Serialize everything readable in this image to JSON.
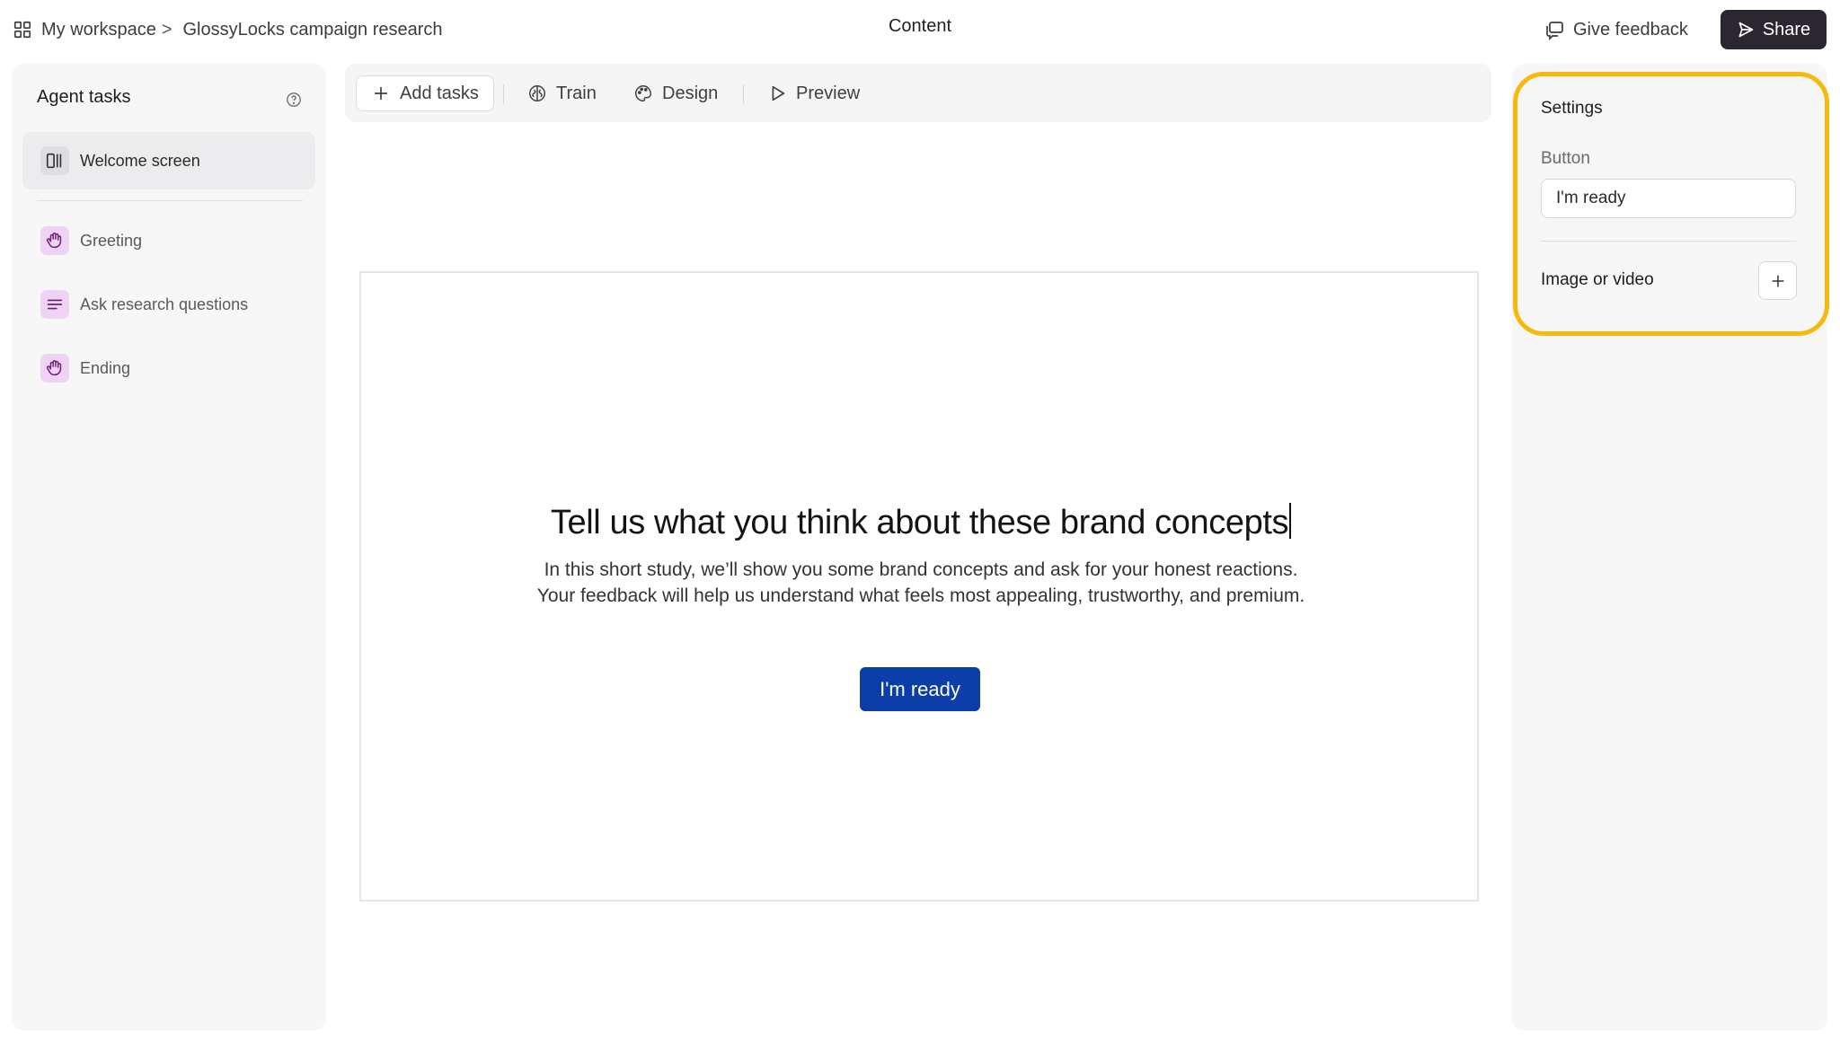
{
  "breadcrumb": {
    "workspace": "My workspace",
    "separator": ">",
    "project": "GlossyLocks campaign research"
  },
  "header": {
    "title": "Content",
    "feedback_label": "Give feedback",
    "share_label": "Share"
  },
  "sidebar": {
    "title": "Agent tasks",
    "items": [
      {
        "label": "Welcome screen",
        "icon": "layout-columns-icon",
        "active": true
      },
      {
        "label": "Greeting",
        "icon": "waving-hand-icon",
        "active": false
      },
      {
        "label": "Ask research questions",
        "icon": "text-lines-icon",
        "active": false
      },
      {
        "label": "Ending",
        "icon": "waving-hand-icon",
        "active": false
      }
    ]
  },
  "toolbar": {
    "add_tasks": "Add tasks",
    "train": "Train",
    "design": "Design",
    "preview": "Preview"
  },
  "canvas": {
    "title": "Tell us what you think about these brand concepts",
    "description": "In this short study, we’ll show you some brand concepts and ask for your honest reactions. Your feedback will help us understand what feels most appealing, trustworthy, and premium.",
    "button_label": "I'm ready"
  },
  "settings": {
    "title": "Settings",
    "button_field_label": "Button",
    "button_field_value": "I'm ready",
    "media_label": "Image or video"
  },
  "colors": {
    "share_button": "#2b2630",
    "primary_button": "#0b3ea8",
    "highlight_outline": "#f6b90d",
    "task_icon_purple": "#efd3f4"
  }
}
